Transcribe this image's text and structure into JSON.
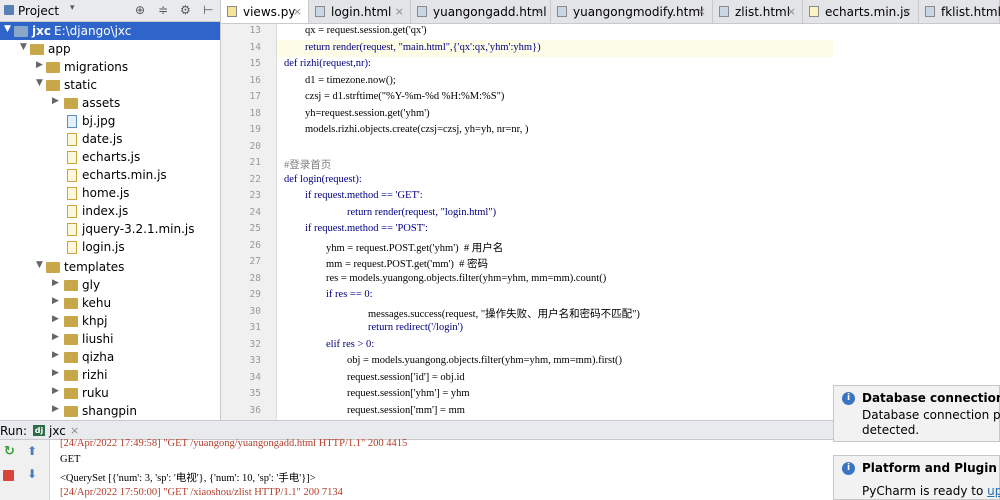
{
  "project_panel": {
    "title": "Project",
    "toolbar_icons": [
      "globe-icon",
      "split-icon",
      "gear-icon",
      "hide-icon"
    ]
  },
  "tree": {
    "root": {
      "name": "jxc",
      "path": "E:\\django\\jxc"
    },
    "items": [
      {
        "label": "app",
        "type": "folder"
      },
      {
        "label": "migrations",
        "type": "folder"
      },
      {
        "label": "static",
        "type": "folder"
      },
      {
        "label": "assets",
        "type": "folder"
      },
      {
        "label": "bj.jpg",
        "type": "img"
      },
      {
        "label": "date.js",
        "type": "js"
      },
      {
        "label": "echarts.js",
        "type": "js"
      },
      {
        "label": "echarts.min.js",
        "type": "js"
      },
      {
        "label": "home.js",
        "type": "js"
      },
      {
        "label": "index.js",
        "type": "js"
      },
      {
        "label": "jquery-3.2.1.min.js",
        "type": "js"
      },
      {
        "label": "login.js",
        "type": "js"
      },
      {
        "label": "templates",
        "type": "folder"
      },
      {
        "label": "gly",
        "type": "folder"
      },
      {
        "label": "kehu",
        "type": "folder"
      },
      {
        "label": "khpj",
        "type": "folder"
      },
      {
        "label": "liushi",
        "type": "folder"
      },
      {
        "label": "qizha",
        "type": "folder"
      },
      {
        "label": "rizhi",
        "type": "folder"
      },
      {
        "label": "ruku",
        "type": "folder"
      },
      {
        "label": "shangpin",
        "type": "folder"
      }
    ]
  },
  "tabs": [
    {
      "label": "views.py",
      "active": true
    },
    {
      "label": "login.html",
      "active": false
    },
    {
      "label": "yuangongadd.html",
      "active": false
    },
    {
      "label": "yuangongmodify.html",
      "active": false
    },
    {
      "label": "zlist.html",
      "active": false
    },
    {
      "label": "echarts.min.js",
      "active": false
    },
    {
      "label": "fklist.html",
      "active": false
    }
  ],
  "code": {
    "lines": [
      {
        "n": "13",
        "indent": 1,
        "text": "qx = request.session.get('qx')"
      },
      {
        "n": "14",
        "indent": 1,
        "text": "return render(request, \"main.html\",{'qx':qx,'yhm':yhm})"
      },
      {
        "n": "15",
        "indent": 0,
        "text": "def rizhi(request,nr):"
      },
      {
        "n": "16",
        "indent": 1,
        "text": "d1 = timezone.now();"
      },
      {
        "n": "17",
        "indent": 1,
        "text": "czsj = d1.strftime(\"%Y-%m-%d %H:%M:%S\")"
      },
      {
        "n": "18",
        "indent": 1,
        "text": "yh=request.session.get('yhm')"
      },
      {
        "n": "19",
        "indent": 1,
        "text": "models.rizhi.objects.create(czsj=czsj, yh=yh, nr=nr, )"
      },
      {
        "n": "20",
        "indent": 0,
        "text": ""
      },
      {
        "n": "21",
        "indent": 0,
        "text": "#登录首页"
      },
      {
        "n": "22",
        "indent": 0,
        "text": "def login(request):"
      },
      {
        "n": "23",
        "indent": 1,
        "text": "if request.method == 'GET':"
      },
      {
        "n": "24",
        "indent": 3,
        "text": "return render(request, \"login.html\")"
      },
      {
        "n": "25",
        "indent": 1,
        "text": "if request.method == 'POST':"
      },
      {
        "n": "26",
        "indent": 2,
        "text": "yhm = request.POST.get('yhm')  # 用户名"
      },
      {
        "n": "27",
        "indent": 2,
        "text": "mm = request.POST.get('mm')  # 密码"
      },
      {
        "n": "28",
        "indent": 2,
        "text": "res = models.yuangong.objects.filter(yhm=yhm, mm=mm).count()"
      },
      {
        "n": "29",
        "indent": 2,
        "text": "if res == 0:"
      },
      {
        "n": "30",
        "indent": 4,
        "text": "messages.success(request, \"操作失败、用户名和密码不匹配\")"
      },
      {
        "n": "31",
        "indent": 4,
        "text": "return redirect('/login')"
      },
      {
        "n": "32",
        "indent": 2,
        "text": "elif res > 0:"
      },
      {
        "n": "33",
        "indent": 3,
        "text": "obj = models.yuangong.objects.filter(yhm=yhm, mm=mm).first()"
      },
      {
        "n": "34",
        "indent": 3,
        "text": "request.session['id'] = obj.id"
      },
      {
        "n": "35",
        "indent": 3,
        "text": "request.session['yhm'] = yhm"
      },
      {
        "n": "36",
        "indent": 3,
        "text": "request.session['mm'] = mm"
      }
    ]
  },
  "notifications": [
    {
      "title": "Database connections det",
      "lines": [
        "Database connection pro",
        "detected."
      ]
    },
    {
      "title": "Platform and Plugin Upda",
      "text": "PyCharm is ready to ",
      "link": "updat"
    }
  ],
  "run_panel": {
    "label": "Run:",
    "config": "jxc",
    "lines": [
      "[24/Apr/2022 17:49:58] \"GET /yuangong/yuangongadd.html HTTP/1.1\" 200 4415",
      "GET",
      "<QuerySet [{'num': 3, 'sp': '电视'}, {'num': 10, 'sp': '手电'}]>",
      "[24/Apr/2022 17:50:00] \"GET /xiaoshou/zlist HTTP/1.1\" 200 7134"
    ]
  },
  "colors": {
    "selection": "#2f65ca",
    "keyword": "#000080",
    "string": "#008000",
    "comment": "#808080",
    "console_red": "#b43c2a"
  }
}
